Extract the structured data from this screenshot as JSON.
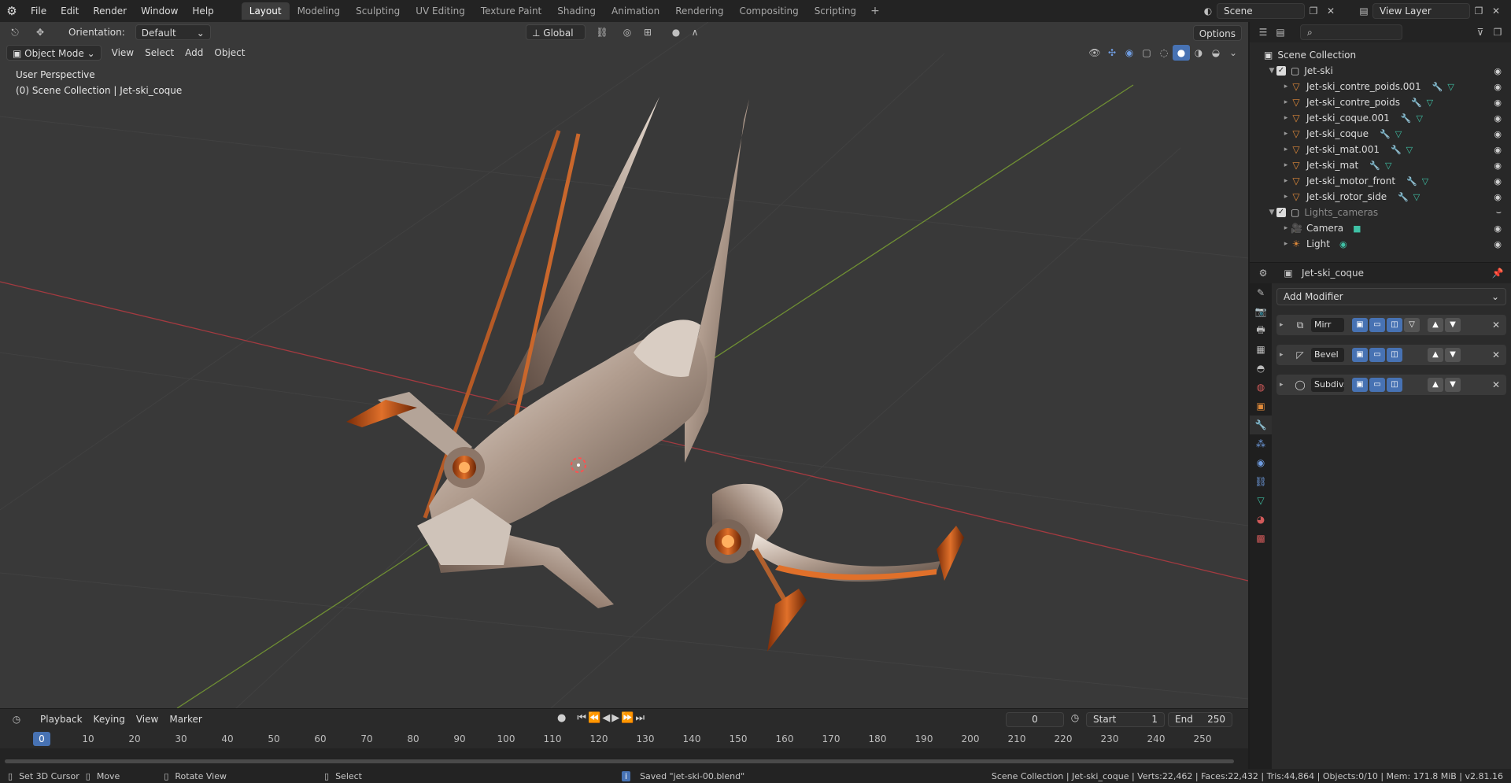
{
  "menu": [
    "File",
    "Edit",
    "Render",
    "Window",
    "Help"
  ],
  "workspaces": [
    {
      "label": "Layout",
      "active": true
    },
    {
      "label": "Modeling",
      "active": false
    },
    {
      "label": "Sculpting",
      "active": false
    },
    {
      "label": "UV Editing",
      "active": false
    },
    {
      "label": "Texture Paint",
      "active": false
    },
    {
      "label": "Shading",
      "active": false
    },
    {
      "label": "Animation",
      "active": false
    },
    {
      "label": "Rendering",
      "active": false
    },
    {
      "label": "Compositing",
      "active": false
    },
    {
      "label": "Scripting",
      "active": false
    }
  ],
  "scene": {
    "name": "Scene",
    "view_layer": "View Layer"
  },
  "tool_header": {
    "orientation_label": "Orientation:",
    "orientation_value": "Default",
    "transform_space": "Global",
    "options": "Options"
  },
  "viewport_header": {
    "mode": "Object Mode",
    "menus": [
      "View",
      "Select",
      "Add",
      "Object"
    ]
  },
  "viewport": {
    "perspective": "User Perspective",
    "context": "(0) Scene Collection | Jet-ski_coque"
  },
  "timeline": {
    "menus": [
      "Playback",
      "Keying",
      "View",
      "Marker"
    ],
    "current_frame": "0",
    "start_label": "Start",
    "start": "1",
    "end_label": "End",
    "end": "250",
    "ticks": [
      "0",
      "10",
      "20",
      "30",
      "40",
      "50",
      "60",
      "70",
      "80",
      "90",
      "100",
      "110",
      "120",
      "130",
      "140",
      "150",
      "160",
      "170",
      "180",
      "190",
      "200",
      "210",
      "220",
      "230",
      "240",
      "250"
    ]
  },
  "outliner": {
    "root": "Scene Collection",
    "collections": [
      {
        "name": "Jet-ski",
        "items": [
          "Jet-ski_contre_poids.001",
          "Jet-ski_contre_poids",
          "Jet-ski_coque.001",
          "Jet-ski_coque",
          "Jet-ski_mat.001",
          "Jet-ski_mat",
          "Jet-ski_motor_front",
          "Jet-ski_rotor_side"
        ]
      },
      {
        "name": "Lights_cameras",
        "items": [
          "Camera",
          "Light"
        ]
      }
    ]
  },
  "properties": {
    "object": "Jet-ski_coque",
    "add_modifier": "Add Modifier",
    "modifiers": [
      "Mirr",
      "Bevel",
      "Subdiv..."
    ]
  },
  "status": {
    "left": [
      "Set 3D Cursor",
      "Move",
      "Rotate View",
      "Select"
    ],
    "message": "Saved \"jet-ski-00.blend\"",
    "info": "Scene Collection | Jet-ski_coque | Verts:22,462 | Faces:22,432 | Tris:44,864 | Objects:0/10 | Mem: 171.8 MiB | v2.81.16"
  },
  "colors": {
    "accent": "#4772b3",
    "mesh_orange": "#e08a3a",
    "x_axis": "#c4444a",
    "y_axis": "#7fa23a",
    "viewport_bg": "#393939"
  }
}
